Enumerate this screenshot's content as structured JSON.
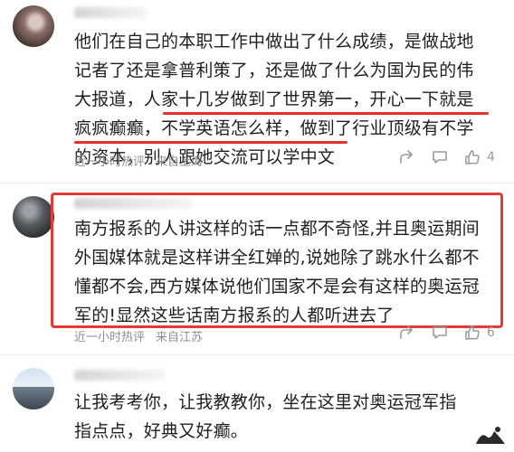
{
  "comments": [
    {
      "lines": [
        "他们在自己的本职工作中做出了什么成绩，是做战地",
        "记者了还是拿普利策了，还是做了什么为国为民的伟",
        "大报道，人家十几岁做到了世界第一，开心一下就是",
        "疯疯癫癫，不学英语怎么样，做到了行业顶级有不学",
        "的资本，别人跟她交流可以学中文"
      ],
      "time": "近一小时热评",
      "location": "来自上海",
      "likes": "4"
    },
    {
      "lines": [
        "南方报系的人讲这样的话一点都不奇怪,并且奥运期间",
        "外国媒体就是这样讲全红婵的,说她除了跳水什么都不",
        "懂都不会,西方媒体说他们国家不是会有这样的奥运冠",
        "军的!显然这些话南方报系的人都听进去了"
      ],
      "time": "近一小时热评",
      "location": "来自江苏",
      "likes": "6"
    },
    {
      "lines": [
        "让我考考你，让我教教你，坐在这里对奥运冠军指",
        "指点点，好典又好癫。"
      ]
    }
  ],
  "colors": {
    "highlight_red": "#e23b36",
    "meta_gray": "#8d8d8d",
    "text": "#1f1f1f"
  },
  "icons": [
    "share-icon",
    "comment-icon",
    "thumbs-up-icon"
  ]
}
